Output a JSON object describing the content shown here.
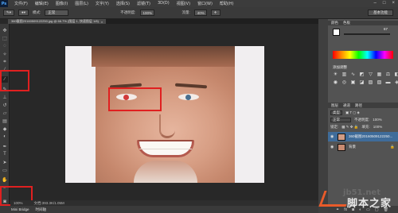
{
  "app": {
    "logo": "Ps"
  },
  "menubar": {
    "items": [
      "文件(F)",
      "编辑(E)",
      "图像(I)",
      "图层(L)",
      "文字(Y)",
      "选择(S)",
      "滤镜(T)",
      "3D(D)",
      "视图(V)",
      "窗口(W)",
      "帮助(H)"
    ]
  },
  "options": {
    "mode_label": "模式:",
    "mode_value": "正常",
    "opacity_label": "不透明度:",
    "opacity_value": "100%",
    "flow_label": "流量:",
    "flow_value": "40%",
    "workspace": "基本功能"
  },
  "document": {
    "tab_title": "360截图20160509122250.jpg @ 66.7% (图层 1, 快速图层 1/8)",
    "close": "×"
  },
  "status": {
    "zoom": "100%",
    "doc_info": "文档:393.3K/1.05M"
  },
  "minibridge": {
    "tab1": "Mini Bridge",
    "tab2": "时间轴"
  },
  "panels": {
    "color_tabs": [
      "颜色",
      "色板"
    ],
    "color_value": "67",
    "adjust_title": "添加调整",
    "layer_tabs": [
      "图层",
      "通道",
      "路径"
    ],
    "kind_label": "类型",
    "blend_value": "正常",
    "opacity_label": "不透明度:",
    "opacity_value": "100%",
    "lock_label": "锁定:",
    "fill_label": "填充:",
    "fill_value": "100%",
    "layers": [
      {
        "name": "360截图20160509122250...",
        "selected": true
      },
      {
        "name": "背景",
        "selected": false
      }
    ]
  },
  "watermark": {
    "site": "jb51.net",
    "brand": "脚本之家"
  },
  "colors": {
    "annotation": "#e02020",
    "selection": "#3f6c9a"
  }
}
